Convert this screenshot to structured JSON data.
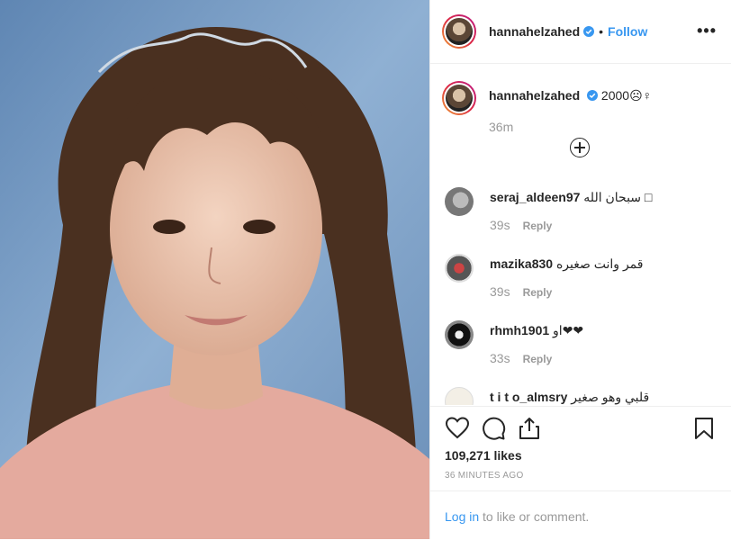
{
  "header": {
    "username": "hannahelzahed",
    "dot": "•",
    "follow_label": "Follow",
    "more_label": "•••"
  },
  "caption": {
    "username": "hannahelzahed",
    "text": "2000☹︎♀",
    "time": "36m"
  },
  "comments": [
    {
      "username": "seraj_aldeen97",
      "text": "سبحان الله □",
      "time": "39s",
      "reply": "Reply"
    },
    {
      "username": "mazika830",
      "text": "قمر وانت صغيره",
      "time": "39s",
      "reply": "Reply"
    },
    {
      "username": "rhmh1901",
      "text": "او❤❤",
      "time": "33s",
      "reply": "Reply"
    },
    {
      "username": "t i t o_almsry",
      "text": "قلبي وهو صغير",
      "time": "",
      "reply": ""
    }
  ],
  "stats": {
    "likes": "109,271 likes",
    "ago": "36 MINUTES AGO"
  },
  "login": {
    "link": "Log in",
    "rest": " to like or comment."
  },
  "colors": {
    "accent": "#3897f0",
    "text": "#262626",
    "muted": "#999999"
  },
  "icons": [
    "heart-icon",
    "comment-icon",
    "share-icon",
    "bookmark-icon",
    "verified-icon",
    "add-comment-icon",
    "more-icon"
  ]
}
